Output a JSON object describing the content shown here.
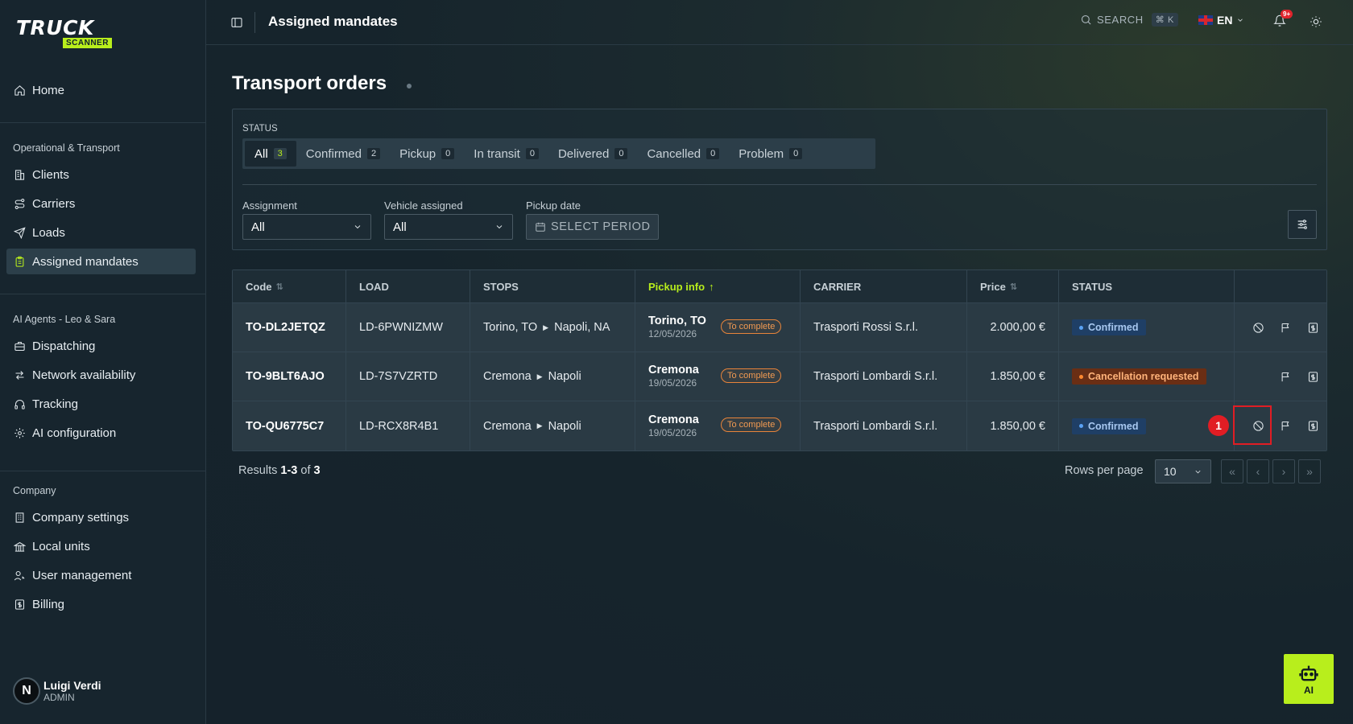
{
  "brand": {
    "logo_top": "TRUCK",
    "logo_bottom": "SCANNER",
    "accent": "#b8ee1c"
  },
  "sidebar": {
    "home": "Home",
    "section_operational": "Operational & Transport",
    "operational_items": [
      "Clients",
      "Carriers",
      "Loads",
      "Assigned mandates"
    ],
    "section_ai": "AI Agents - Leo & Sara",
    "ai_items": [
      "Dispatching",
      "Network availability",
      "Tracking",
      "AI configuration"
    ],
    "section_company": "Company",
    "company_items": [
      "Company settings",
      "Local units",
      "User management",
      "Billing"
    ],
    "user": {
      "initial": "N",
      "name": "Luigi Verdi",
      "role": "ADMIN"
    }
  },
  "header": {
    "title": "Assigned mandates",
    "search_label": "SEARCH",
    "search_shortcut": "⌘ K",
    "language": "EN",
    "notification_count": "9+"
  },
  "page": {
    "title": "Transport orders"
  },
  "filters": {
    "status_label": "STATUS",
    "tabs": [
      {
        "label": "All",
        "count": "3"
      },
      {
        "label": "Confirmed",
        "count": "2"
      },
      {
        "label": "Pickup",
        "count": "0"
      },
      {
        "label": "In transit",
        "count": "0"
      },
      {
        "label": "Delivered",
        "count": "0"
      },
      {
        "label": "Cancelled",
        "count": "0"
      },
      {
        "label": "Problem",
        "count": "0"
      }
    ],
    "assignment_label": "Assignment",
    "assignment_value": "All",
    "vehicle_label": "Vehicle assigned",
    "vehicle_value": "All",
    "pickup_label": "Pickup date",
    "pickup_placeholder": "SELECT PERIOD"
  },
  "table": {
    "columns": [
      "Code",
      "LOAD",
      "STOPS",
      "Pickup info",
      "CARRIER",
      "Price",
      "STATUS"
    ],
    "rows": [
      {
        "code": "TO-DL2JETQZ",
        "load": "LD-6PWNIZMW",
        "stop_from": "Torino, TO",
        "stop_to": "Napoli, NA",
        "pickup_city": "Torino, TO",
        "pickup_date": "12/05/2026",
        "pickup_tag": "To complete",
        "carrier": "Trasporti Rossi S.r.l.",
        "price": "2.000,00 €",
        "status": "Confirmed"
      },
      {
        "code": "TO-9BLT6AJO",
        "load": "LD-7S7VZRTD",
        "stop_from": "Cremona",
        "stop_to": "Napoli",
        "pickup_city": "Cremona",
        "pickup_date": "19/05/2026",
        "pickup_tag": "To complete",
        "carrier": "Trasporti Lombardi S.r.l.",
        "price": "1.850,00 €",
        "status": "Cancellation requested"
      },
      {
        "code": "TO-QU6775C7",
        "load": "LD-RCX8R4B1",
        "stop_from": "Cremona",
        "stop_to": "Napoli",
        "pickup_city": "Cremona",
        "pickup_date": "19/05/2026",
        "pickup_tag": "To complete",
        "carrier": "Trasporti Lombardi S.r.l.",
        "price": "1.850,00 €",
        "status": "Confirmed"
      }
    ]
  },
  "footer": {
    "results_prefix": "Results ",
    "results_range": "1-3",
    "results_of": " of ",
    "results_total": "3",
    "rows_per_page_label": "Rows per page",
    "rows_per_page_value": "10"
  },
  "annotation": {
    "marker": "1"
  },
  "ai_button": {
    "label": "AI"
  }
}
